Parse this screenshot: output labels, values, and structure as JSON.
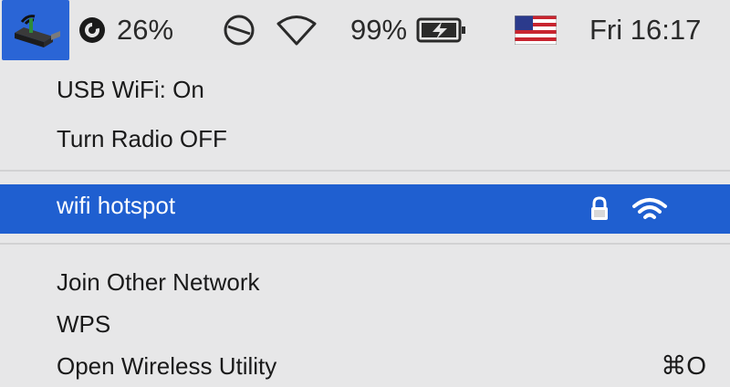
{
  "menubar": {
    "cpu_label": "26%",
    "battery_label": "99%",
    "clock": "Fri 16:17",
    "icons": [
      "usb-wifi-dongle-icon",
      "cpu-gauge-icon",
      "do-not-disturb-icon",
      "wifi-outline-icon",
      "battery-charging-icon",
      "us-flag-icon"
    ]
  },
  "menu": {
    "status": "USB WiFi: On",
    "radio_toggle": "Turn Radio OFF",
    "network": {
      "name": "wifi hotspot",
      "secured": true,
      "signal_bars": 3
    },
    "join_other": "Join Other Network",
    "wps": "WPS",
    "open_utility": "Open Wireless Utility",
    "open_utility_shortcut": "⌘O"
  },
  "colors": {
    "highlight": "#1f5fd0",
    "menu_bg": "#e7e7e8",
    "text": "#1a1a1a"
  }
}
